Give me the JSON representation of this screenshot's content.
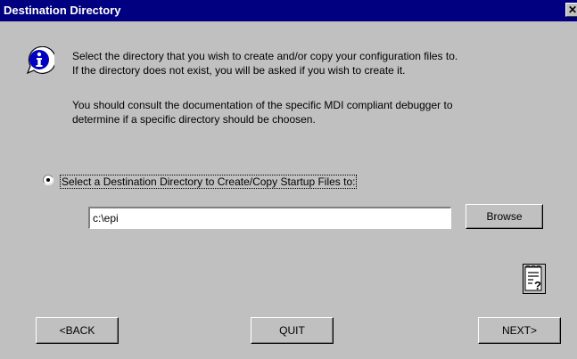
{
  "window": {
    "title": "Destination Directory",
    "close_glyph": "✕"
  },
  "info": {
    "icon": "info-icon",
    "lines": [
      "Select the directory that you wish to create and/or copy your configuration files to.",
      "If the directory does not exist, you will be asked if you wish to create it.",
      "You should consult the documentation of the specific MDI compliant debugger to",
      "determine if a specific directory should be choosen."
    ]
  },
  "destination": {
    "option_label": "Select a Destination Directory to Create/Copy Startup Files to:",
    "selected": true,
    "path_value": "c:\\epi",
    "browse_label": "Browse"
  },
  "help": {
    "icon": "help-document-icon"
  },
  "nav": {
    "back_label": "<BACK",
    "quit_label": "QUIT",
    "next_label": "NEXT>"
  },
  "colors": {
    "titlebar": "#000080",
    "face": "#c0c0c0",
    "info_blue": "#0000c0"
  }
}
